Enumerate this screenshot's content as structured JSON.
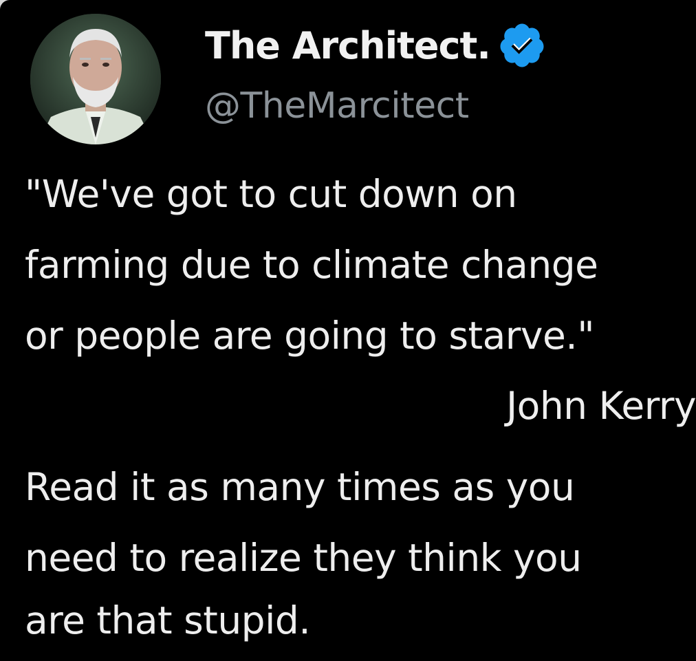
{
  "tweet": {
    "display_name": "The Architect.",
    "handle": "@TheMarcitect",
    "verified": true,
    "quote_lines": [
      "\"We've got to cut down on",
      "farming due to climate change",
      "or people are going to starve.\""
    ],
    "attribution": "John Kerry",
    "comment_lines": [
      "Read it as many times as you",
      "need to realize they think you",
      "are that stupid."
    ]
  },
  "colors": {
    "background": "#000000",
    "text": "#eeeeee",
    "handle": "#8b9298",
    "verified_badge": "#1d9bf0"
  },
  "icons": {
    "verified": "verified-checkmark-badge",
    "avatar": "profile-photo-gray-haired-man"
  }
}
